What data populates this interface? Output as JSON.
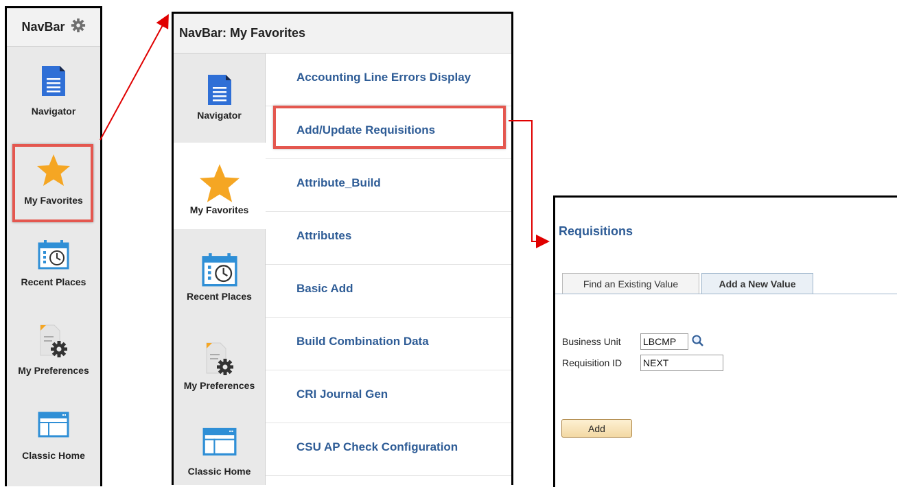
{
  "navbar": {
    "title": "NavBar",
    "settings_icon": "gear-icon",
    "items": [
      {
        "label": "Navigator",
        "icon": "document-icon"
      },
      {
        "label": "My Favorites",
        "icon": "star-icon"
      },
      {
        "label": "Recent Places",
        "icon": "calendar-clock-icon"
      },
      {
        "label": "My Preferences",
        "icon": "preferences-gear-icon"
      },
      {
        "label": "Classic Home",
        "icon": "window-icon"
      }
    ]
  },
  "favorites": {
    "title": "NavBar: My Favorites",
    "side_items": [
      {
        "label": "Navigator"
      },
      {
        "label": "My Favorites"
      },
      {
        "label": "Recent Places"
      },
      {
        "label": "My Preferences"
      },
      {
        "label": "Classic Home"
      }
    ],
    "links": [
      "Accounting Line Errors Display",
      "Add/Update Requisitions",
      "Attribute_Build",
      "Attributes",
      "Basic Add",
      "Build Combination Data",
      "CRI Journal Gen",
      "CSU AP Check Configuration"
    ]
  },
  "requisitions": {
    "title": "Requisitions",
    "tabs": {
      "find": "Find an Existing Value",
      "add": "Add a New Value"
    },
    "fields": {
      "business_unit_label": "Business Unit",
      "business_unit_value": "LBCMP",
      "requisition_id_label": "Requisition ID",
      "requisition_id_value": "NEXT"
    },
    "add_button": "Add"
  },
  "colors": {
    "highlight": "#e4574f",
    "link": "#2e5c96",
    "star": "#f5a623",
    "arrow": "#e00000"
  }
}
